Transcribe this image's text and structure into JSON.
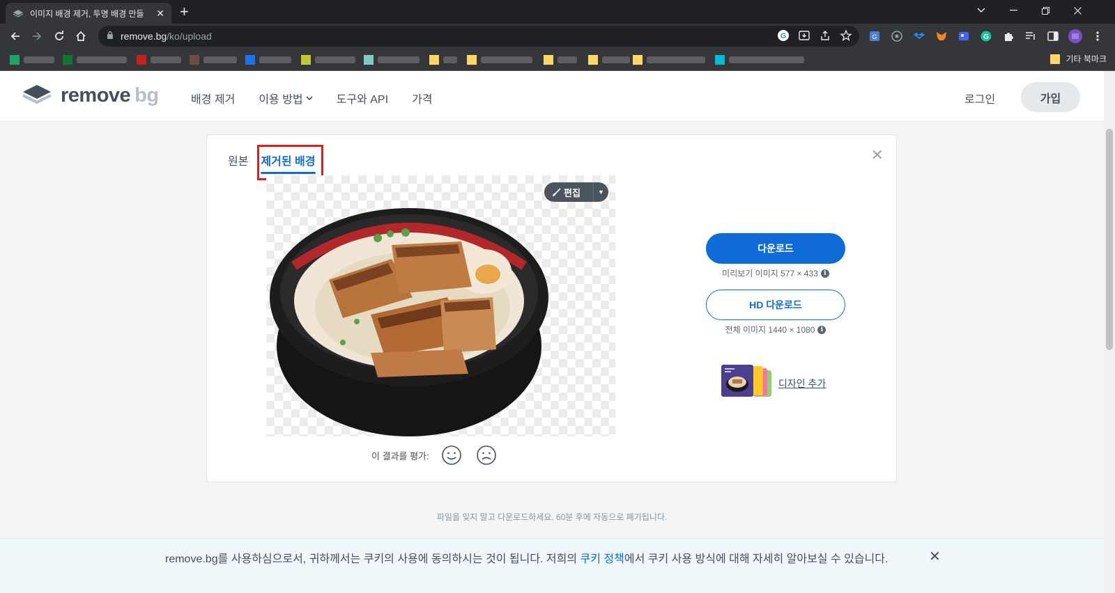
{
  "browser": {
    "tab_title": "이미지 배경 제거, 투명 배경 만들",
    "url_host": "remove.bg",
    "url_path": "/ko/upload",
    "other_bookmarks": "기타 북마크"
  },
  "header": {
    "logo_main": "remove",
    "logo_accent": "bg",
    "nav": [
      "배경 제거",
      "이용 방법",
      "도구와 API",
      "가격"
    ],
    "login": "로그인",
    "signup": "가입"
  },
  "editor": {
    "tab_original": "원본",
    "tab_removed": "제거된 배경",
    "edit_label": "편집",
    "rate_label": "이 결과를 평가:",
    "download_label": "다운로드",
    "download_info": "미리보기 이미지 577 × 433",
    "hd_download_label": "HD 다운로드",
    "hd_download_info": "전체 이미지 1440 × 1080",
    "design_label": "디자인 추가"
  },
  "notice": "파일을 잊지 말고 다운로드하세요. 60분 후에 자동으로 폐기됩니다.",
  "cookie": {
    "text_before": "remove.bg를 사용하심으로서, 귀하께서는 쿠키의 사용에 동의하시는 것이 됩니다. 저희의 ",
    "link": "쿠키 정책",
    "text_after": "에서 쿠키 사용 방식에 대해 자세히 알아보실 수 있습니다."
  },
  "colors": {
    "accent": "#0f6bd6",
    "highlight": "#e01e1e",
    "chrome_dark": "#202124",
    "chrome_mid": "#35363a"
  }
}
